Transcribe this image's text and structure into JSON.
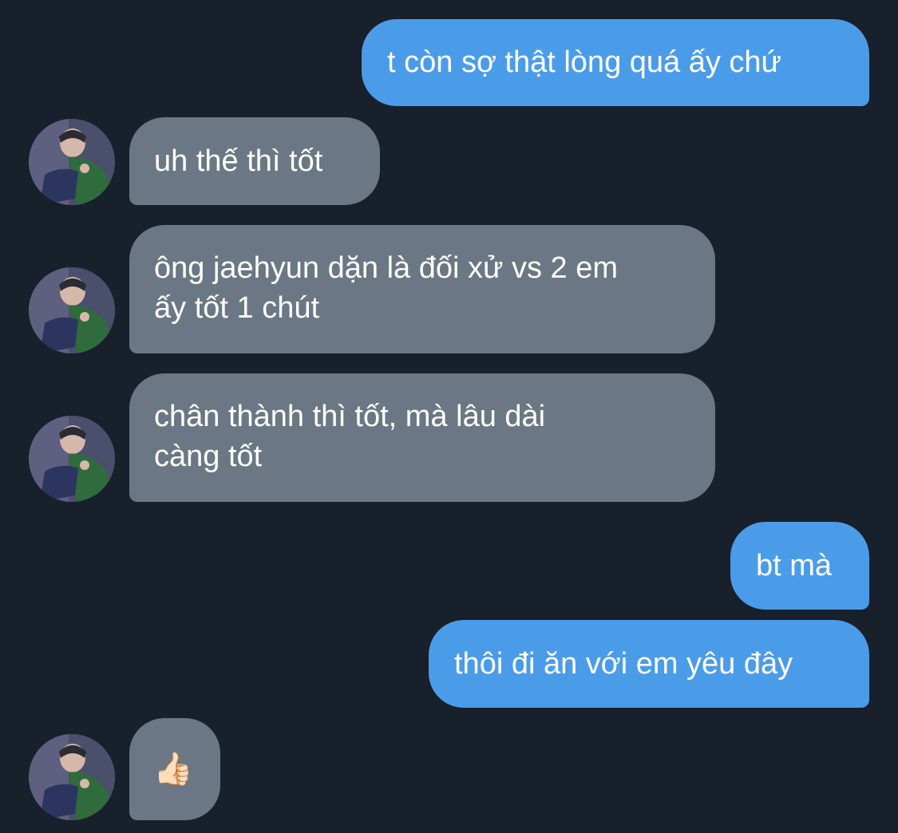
{
  "messages": [
    {
      "direction": "sent",
      "lines": [
        "t còn sợ thật lòng quá ấy chứ"
      ]
    },
    {
      "direction": "received",
      "lines": [
        "uh thế thì tốt"
      ]
    },
    {
      "direction": "received",
      "lines": [
        "ông jaehyun dặn là đối xử vs 2 em",
        "ấy tốt 1 chút"
      ]
    },
    {
      "direction": "received",
      "lines": [
        "chân thành thì tốt, mà lâu dài",
        "càng tốt"
      ]
    },
    {
      "direction": "sent",
      "lines": [
        "bt mà"
      ]
    },
    {
      "direction": "sent",
      "lines": [
        "thôi đi ăn với em yêu đây"
      ]
    },
    {
      "direction": "received",
      "lines": [
        "👍🏻"
      ]
    }
  ],
  "colors": {
    "background": "#17202b",
    "sent_bubble": "#4b9ce8",
    "received_bubble": "#6b7784",
    "text": "#ffffff"
  },
  "icons": {
    "contact_avatar": "avatar-photo"
  }
}
